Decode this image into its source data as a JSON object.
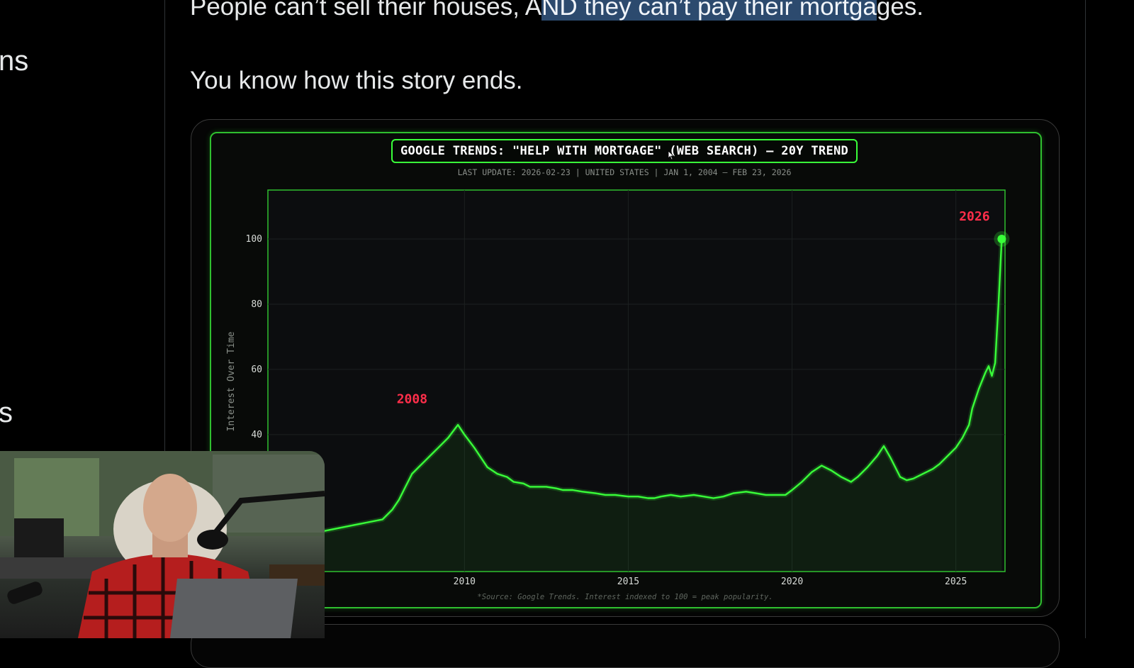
{
  "post": {
    "line1_before": "People can’t sell their houses, A",
    "line1_highlight": "ND they can’t pay their mortga",
    "line1_after": "ges.",
    "line2": "You know how this story ends."
  },
  "left_column": {
    "frag_top": "ns",
    "frag_mid": "s"
  },
  "chart_data": {
    "type": "area",
    "title": "GOOGLE TRENDS: \"HELP WITH MORTGAGE\" (WEB SEARCH) — 20Y TREND",
    "subtitle": "LAST UPDATE: 2026-02-23  |  UNITED STATES  |  JAN 1, 2004 – FEB 23, 2026",
    "ylabel": "Interest Over Time",
    "xlabel": "",
    "source": "*Source: Google Trends. Interest indexed to 100 = peak popularity.",
    "x_ticks": [
      "2010",
      "2015",
      "2020",
      "2025"
    ],
    "y_ticks": [
      "40",
      "60",
      "80",
      "100"
    ],
    "xlim": [
      2004.0,
      2026.5
    ],
    "ylim": [
      -2,
      115
    ],
    "line_color": "#39ff39",
    "annotation_color": "#ff2e4a",
    "annotations": [
      {
        "label": "2008",
        "x": 2008.4,
        "y": 44
      },
      {
        "label": "2026",
        "x": 2026.0,
        "y": 100
      }
    ],
    "x": [
      2004.0,
      2004.3,
      2004.6,
      2005.0,
      2005.5,
      2006.0,
      2006.5,
      2007.0,
      2007.5,
      2007.8,
      2008.0,
      2008.2,
      2008.4,
      2008.6,
      2008.8,
      2009.0,
      2009.2,
      2009.5,
      2009.8,
      2010.0,
      2010.3,
      2010.5,
      2010.7,
      2011.0,
      2011.3,
      2011.5,
      2011.8,
      2012.0,
      2012.5,
      2012.8,
      2013.0,
      2013.3,
      2013.6,
      2014.0,
      2014.3,
      2014.6,
      2015.0,
      2015.3,
      2015.6,
      2015.8,
      2016.0,
      2016.3,
      2016.6,
      2017.0,
      2017.3,
      2017.6,
      2017.9,
      2018.2,
      2018.6,
      2018.9,
      2019.2,
      2019.5,
      2019.8,
      2020.0,
      2020.3,
      2020.6,
      2020.9,
      2021.2,
      2021.5,
      2021.8,
      2022.0,
      2022.3,
      2022.6,
      2022.8,
      2023.0,
      2023.3,
      2023.5,
      2023.7,
      2024.0,
      2024.3,
      2024.5,
      2024.7,
      2025.0,
      2025.2,
      2025.4,
      2025.5,
      2025.7,
      2025.9,
      2026.0,
      2026.1,
      2026.2,
      2026.3,
      2026.4
    ],
    "y": [
      7,
      7.5,
      8,
      9,
      10,
      11,
      12,
      13,
      14,
      17,
      20,
      24,
      28,
      30,
      32,
      34,
      36,
      39,
      43,
      40,
      36,
      33,
      30,
      28,
      27,
      25.5,
      25,
      24,
      24,
      23.5,
      23,
      23,
      22.5,
      22,
      21.5,
      21.5,
      21,
      21,
      20.5,
      20.5,
      21,
      21.5,
      21,
      21.5,
      21,
      20.5,
      21,
      22,
      22.5,
      22,
      21.5,
      21.5,
      21.5,
      23,
      25.5,
      28.5,
      30.5,
      29,
      27,
      25.5,
      27,
      30,
      33.5,
      36.5,
      33,
      27,
      26,
      26.5,
      28,
      29.5,
      31,
      33,
      36,
      39,
      43,
      48,
      54,
      59,
      61,
      58,
      62,
      80,
      100
    ]
  }
}
